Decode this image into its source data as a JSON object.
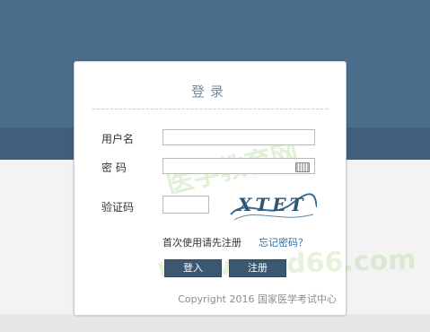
{
  "login": {
    "title": "登录",
    "username_label": "用户名",
    "password_label": "密 码",
    "captcha_label": "验证码",
    "captcha_text": "XTET",
    "hint": "首次使用请先注册",
    "forgot": "忘记密码？",
    "login_button": "登入",
    "register_button": "注册",
    "copyright": "Copyright 2016 国家医学考试中心"
  },
  "watermark": {
    "line1": "医学教育网",
    "line2": "www.med66.com"
  },
  "colors": {
    "header": "#4a6d8c",
    "band": "#3f5f7d",
    "button": "#3b5870",
    "link": "#2e6ea0"
  }
}
